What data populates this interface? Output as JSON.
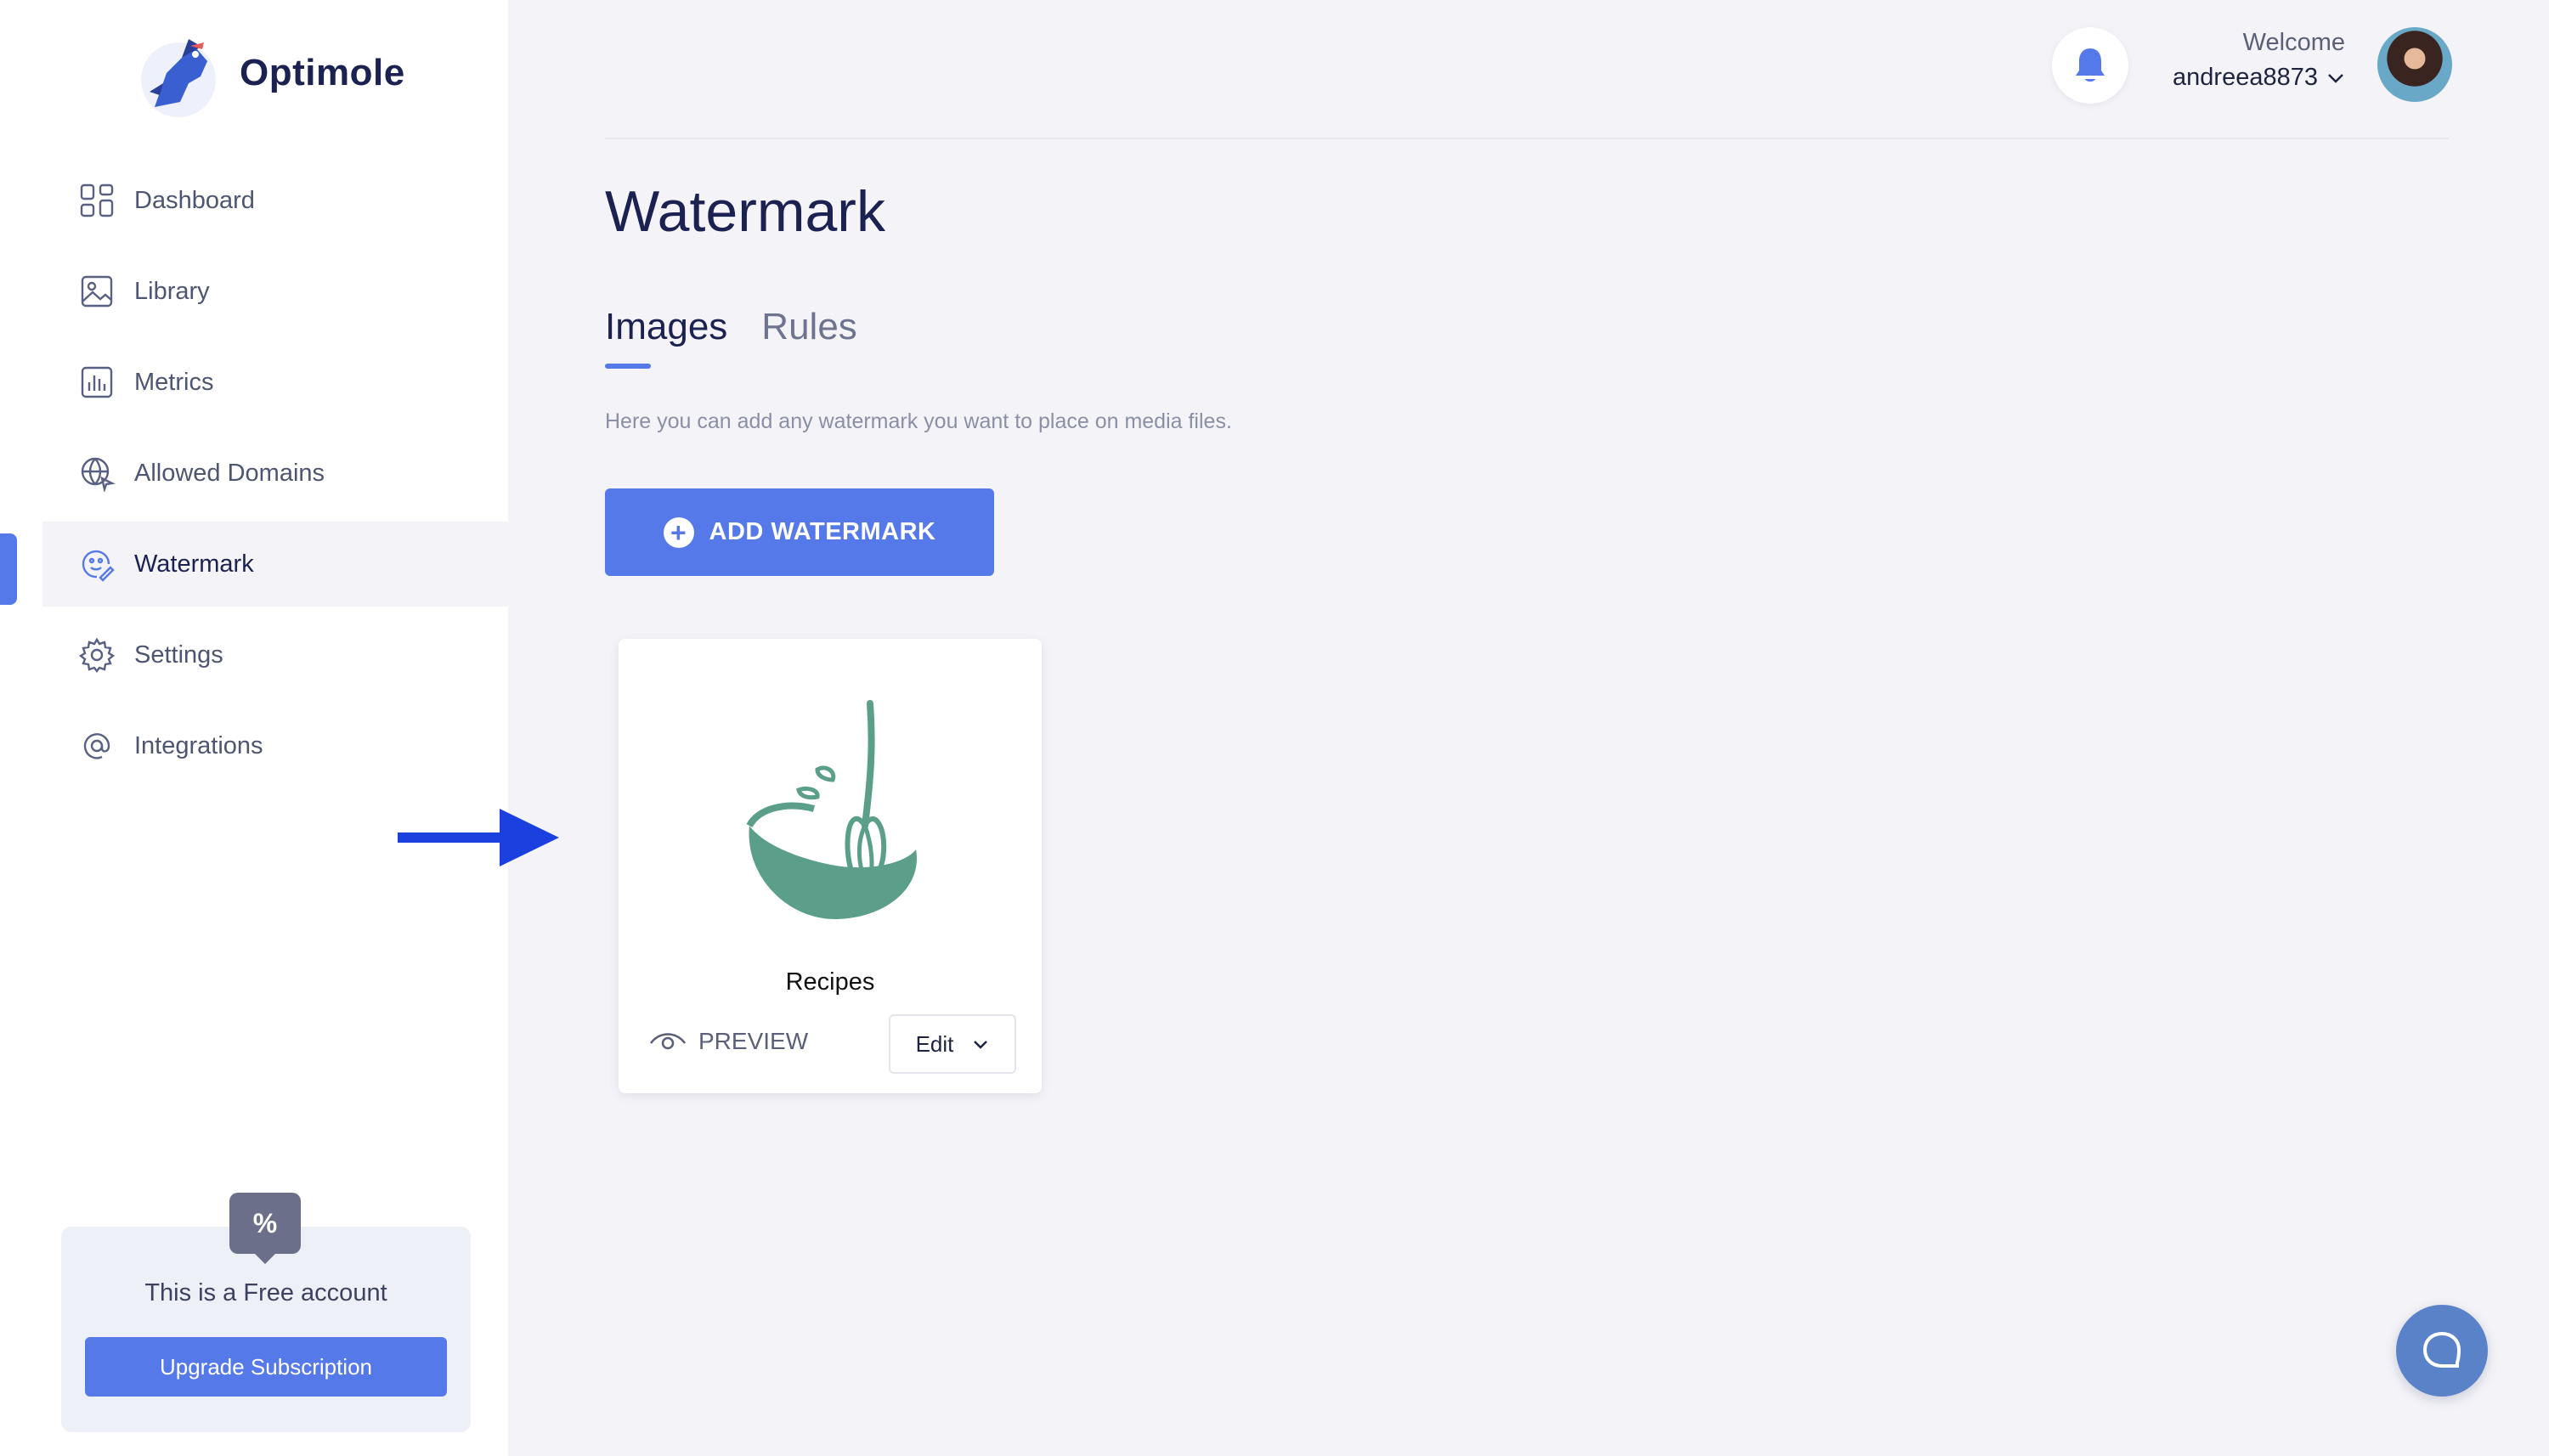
{
  "brand": {
    "name": "Optimole"
  },
  "sidebar": {
    "items": [
      {
        "label": "Dashboard",
        "icon": "dashboard-grid-icon"
      },
      {
        "label": "Library",
        "icon": "image-icon"
      },
      {
        "label": "Metrics",
        "icon": "bar-chart-icon"
      },
      {
        "label": "Allowed Domains",
        "icon": "globe-icon"
      },
      {
        "label": "Watermark",
        "icon": "watermark-icon",
        "active": true
      },
      {
        "label": "Settings",
        "icon": "gear-icon"
      },
      {
        "label": "Integrations",
        "icon": "at-sign-icon"
      }
    ],
    "promo": {
      "badge": "%",
      "text": "This is a Free account",
      "button": "Upgrade Subscription"
    }
  },
  "header": {
    "welcome": "Welcome",
    "username": "andreea8873"
  },
  "main": {
    "title": "Watermark",
    "tabs": [
      {
        "label": "Images",
        "active": true
      },
      {
        "label": "Rules",
        "active": false
      }
    ],
    "helper_text": "Here you can add any watermark you want to place on media files.",
    "add_button": "ADD WATERMARK",
    "watermarks": [
      {
        "name": "Recipes",
        "preview_label": "PREVIEW",
        "edit_label": "Edit"
      }
    ]
  },
  "colors": {
    "accent": "#5579e8",
    "arrow": "#1a40e0",
    "recipe_icon": "#5b9e8a",
    "chat": "#5a82c8"
  }
}
